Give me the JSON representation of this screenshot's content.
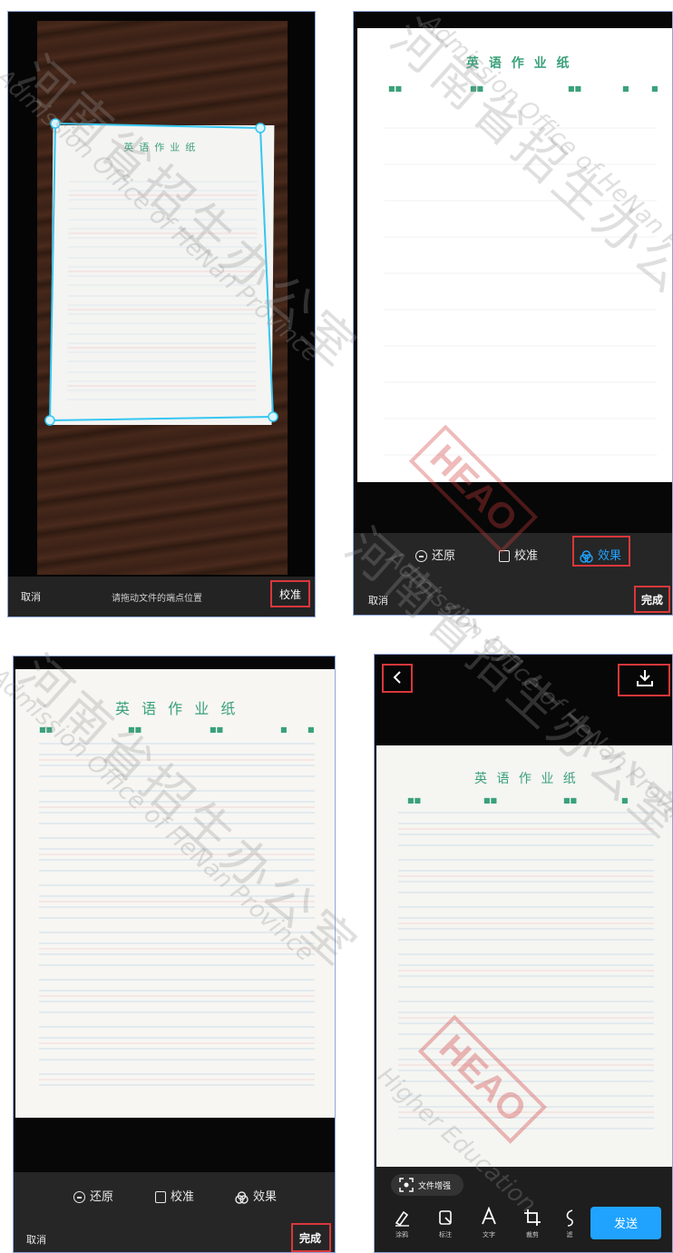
{
  "panel1": {
    "cancel": "取消",
    "hint": "请拖动文件的端点位置",
    "calibrate_button": "校准",
    "paper_title": "英语作业纸"
  },
  "panel2": {
    "paper_title": "英 语 作 业 纸",
    "restore": "还原",
    "calibrate": "校准",
    "effect": "效果",
    "cancel": "取消",
    "done": "完成"
  },
  "panel3": {
    "paper_title": "英 语 作 业 纸",
    "restore": "还原",
    "calibrate": "校准",
    "effect": "效果",
    "cancel": "取消",
    "done": "完成"
  },
  "panel4": {
    "paper_title": "英 语 作 业 纸",
    "enhance_chip": "文件增强",
    "tools": [
      {
        "label": "涂鸦",
        "icon": "pen-icon"
      },
      {
        "label": "标注",
        "icon": "annotate-icon"
      },
      {
        "label": "文字",
        "icon": "text-icon"
      },
      {
        "label": "裁剪",
        "icon": "crop-icon"
      },
      {
        "label": "滤",
        "icon": "filter-icon"
      }
    ],
    "send": "发送"
  },
  "watermark": {
    "cn": "河南省招生办公室",
    "en": "Admission Office of HeNan Province",
    "en2": "Higher Education",
    "stamp": "HEAO"
  },
  "colors": {
    "accent_blue": "#1fa3ff",
    "highlight_red": "#d9373b",
    "paper_green": "#3aa17a",
    "dark_bar": "#2b2b2b"
  }
}
